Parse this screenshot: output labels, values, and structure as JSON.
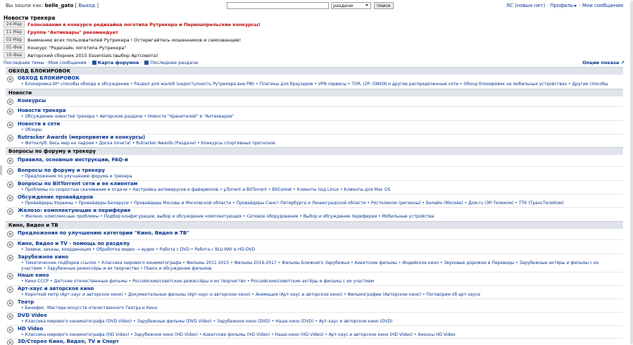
{
  "topbar": {
    "login_prefix": "Вы зашли как:",
    "username": "belle_gato",
    "logout": "[ Выход ]",
    "search_select": "раздачи",
    "search_button": "поиск",
    "pm_link": "ЛС (новых нет)",
    "sep": "·",
    "profile_link": "Профиль",
    "my_messages": "Мои сообщения"
  },
  "news": {
    "title": "Новости трекера",
    "items": [
      {
        "date": "24-Мар",
        "text": "Голосование в конкурсе редизайна логотипа Рутрекера и Первоапрельские конкурсы!",
        "red": true
      },
      {
        "date": "11-Мар",
        "text": "Группа \"Антиквары\" рекомендует",
        "red": true
      },
      {
        "date": "02-Мар",
        "text": "Вниманию всех пользователей Рутрекера ! Остерегайтесь мошенников и самозванцев!",
        "red": false
      },
      {
        "date": "01-Фев",
        "text": "Конкурс \"Редизайн логотипа Рутрекера\"",
        "red": false
      },
      {
        "date": "16-Фев",
        "text": "Авторский сборник 2015 Essentials (выбор Артсовета)",
        "red": false
      }
    ]
  },
  "sublinks": {
    "latest": "Последние темы",
    "my_posts": "Мои сообщения",
    "map": "Карта форумов",
    "latest_torrents": "Последние раздачи",
    "options": "Опции показа"
  },
  "categories": [
    {
      "title": "ОБХОД БЛОКИРОВОК"
    },
    {
      "title": "Новости"
    },
    {
      "title": "Вопросы по форуму и трекеру"
    },
    {
      "title": "Кино, Видео и ТВ"
    }
  ],
  "forums": [
    {
      "name": "ОБХОД БЛОКИРОВОК",
      "subs": "• Блокировка bt* способы обхода и обсуждение • Раздел для жалоб (недоступность Рутрекера вне РФ) • Плагины для браузеров • VPN сервисы • TOR, I2P, ONION и другие распределенные сети • Обход блокировок на мобильных устройствах • Другие способы"
    },
    {
      "name": "Конкурсы",
      "subs": ""
    },
    {
      "name": "Новости трекера",
      "subs": "• Обсуждение новостей трекера • Авторские раздачи • Новости \"Хранителей\" и \"Антикваров\""
    },
    {
      "name": "Новости в сети",
      "subs": "• Обзоры"
    },
    {
      "name": "Rutracker Awards (мероприятия и конкурсы)",
      "subs": "• Фотоклуб. Весь мир на ладони • Доска почета! • Rutracker Awards (Раздачи) • Конкурсы спортивных прогнозов"
    },
    {
      "name": "Правила, основные инструкции, FAQ-и",
      "subs": ""
    },
    {
      "name": "Вопросы по форуму и трекеру",
      "subs": "• Предложения по улучшению форума и трекера"
    },
    {
      "name": "Вопросы по BitTorrent сети и ее клиентам",
      "subs": "• Проблемы со скоростью скачивания и отдачи • Настройка антивирусов и файерволов • µTorrent и BitTorrent • BitComet • Клиенты под Linux • Клиенты для Mac OS"
    },
    {
      "name": "Обсуждение провайдеров",
      "subs": "• Провайдеры Украины • Провайдеры Беларуси • Провайдеры Москвы и Московской области • Провайдеры Санкт-Петербурга и Ленинградской области • Ростелеком (регионы) • Билайн (Москва) • Дом.ru (ЭР-Телеком) • ТТК (ТрансТелеКом)"
    },
    {
      "name": "Железо: комплектующие и периферия",
      "subs": "• Железо: комплексные проблемы • Подбор конфигурации, выбор и обсуждение комплектующих • Сетевое оборудование • Выбор и обсуждение периферии • Мобильные устройства"
    },
    {
      "name": "Предложения по улучшению категории \"Кино, Видео и ТВ\"",
      "subs": ""
    },
    {
      "name": "Кино, Видео и TV - помощь по разделу",
      "subs": "• Заявки, заказы, координация • Обработка видео → аудио • Работа с DVD • Работа с BLU RAY и HD-DVD"
    },
    {
      "name": "Зарубежное кино",
      "subs": "• Тематические подборки ссылок • Классика мирового кинематографа • Фильмы 2011-2015 • Фильмы 2016-2017 • Фильмы Ближнего Зарубежья • Азиатские фильмы • Индийское кино • Звуковые дорожки и Переводы • Зарубежные актёры и фильмы с их участием • Зарубежные режиссёры и их творчество • Поиск и обсуждение фильмов"
    },
    {
      "name": "Наше кино",
      "subs": "• Кино СССР • Детские отечественные фильмы • Российские/советские режиссёры и их творчество • Российские/советские актёры и фильмы с их участием"
    },
    {
      "name": "Арт-хаус и авторское кино",
      "subs": "• Короткий метр (Арт-хаус и авторское кино) • Документальные фильмы (Арт-хаус и авторское кино) • Анимация (Арт-хаус и авторское кино) • Фильмографии (Авторское кино) • Поговорим об арт-хаусе"
    },
    {
      "name": "Театр",
      "subs": "• Бенефис. Мастера искусств отечественного Театра и Кино"
    },
    {
      "name": "DVD Video",
      "subs": "• Классика мирового кинематографа (DVD Video) • Зарубежные фильмы (DVD Video) • Зарубежное кино (DVD) • Наше кино (DVD) • Арт-хаус и авторское кино (DVD)"
    },
    {
      "name": "HD Video",
      "subs": "• Классика мирового кинематографа (HD Video) • Зарубежное кино (HD Video) • Азиатские фильмы (HD Video) • Наше кино (HD Video) • Арт-хаус и авторское кино (HD Video) • Анонсы HD Video"
    },
    {
      "name": "3D/Стерео Кино, Видео, TV и Спорт",
      "subs": ""
    }
  ]
}
